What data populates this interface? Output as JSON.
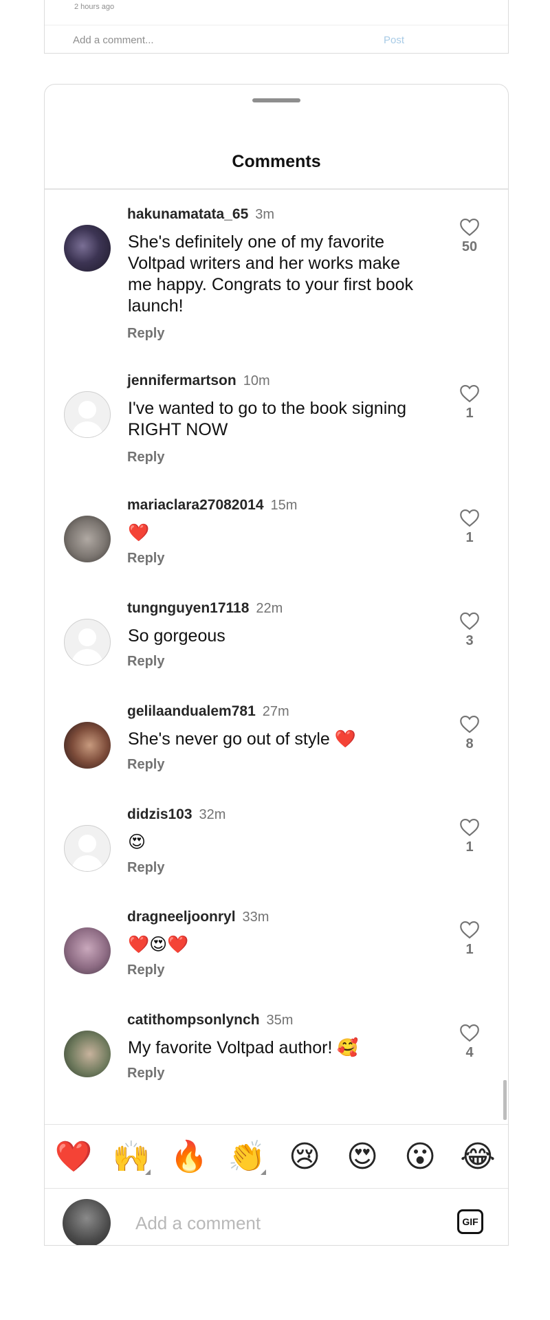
{
  "post": {
    "time": "2 hours ago",
    "add_comment_placeholder": "Add a comment...",
    "post_label": "Post"
  },
  "sheet": {
    "title": "Comments"
  },
  "comments": [
    {
      "user": "hakunamatata_65",
      "time": "3m",
      "text": "She's definitely one of my favorite Voltpad writers and her works make me happy. Congrats to your first book launch!",
      "reply": "Reply",
      "likes": "50",
      "avatar": "photo"
    },
    {
      "user": "jennifermartson",
      "time": "10m",
      "text": "I've wanted to go to the book signing RIGHT NOW",
      "reply": "Reply",
      "likes": "1",
      "avatar": "default"
    },
    {
      "user": "mariaclara27082014",
      "time": "15m",
      "text": "❤️",
      "reply": "Reply",
      "likes": "1",
      "avatar": "photo"
    },
    {
      "user": "tungnguyen17118",
      "time": "22m",
      "text": "So gorgeous",
      "reply": "Reply",
      "likes": "3",
      "avatar": "default"
    },
    {
      "user": "gelilaandualem781",
      "time": "27m",
      "text": "She's never go out of style ❤️",
      "reply": "Reply",
      "likes": "8",
      "avatar": "photo"
    },
    {
      "user": "didzis103",
      "time": "32m",
      "text": "😍",
      "reply": "Reply",
      "likes": "1",
      "avatar": "default"
    },
    {
      "user": "dragneeljoonryl",
      "time": "33m",
      "text": "❤️😍❤️",
      "reply": "Reply",
      "likes": "1",
      "avatar": "photo"
    },
    {
      "user": "catithompsonlynch",
      "time": "35m",
      "text": "My favorite Voltpad author! 🥰",
      "reply": "Reply",
      "likes": "4",
      "avatar": "photo"
    }
  ],
  "emoji_bar": [
    "❤️",
    "🙌",
    "🔥",
    "👏",
    "😢",
    "😍",
    "😮",
    "😂"
  ],
  "composer": {
    "placeholder": "Add a comment",
    "gif_label": "GIF"
  },
  "colors": {
    "accent_link": "#a8cbe6",
    "secondary_text": "#737373"
  }
}
